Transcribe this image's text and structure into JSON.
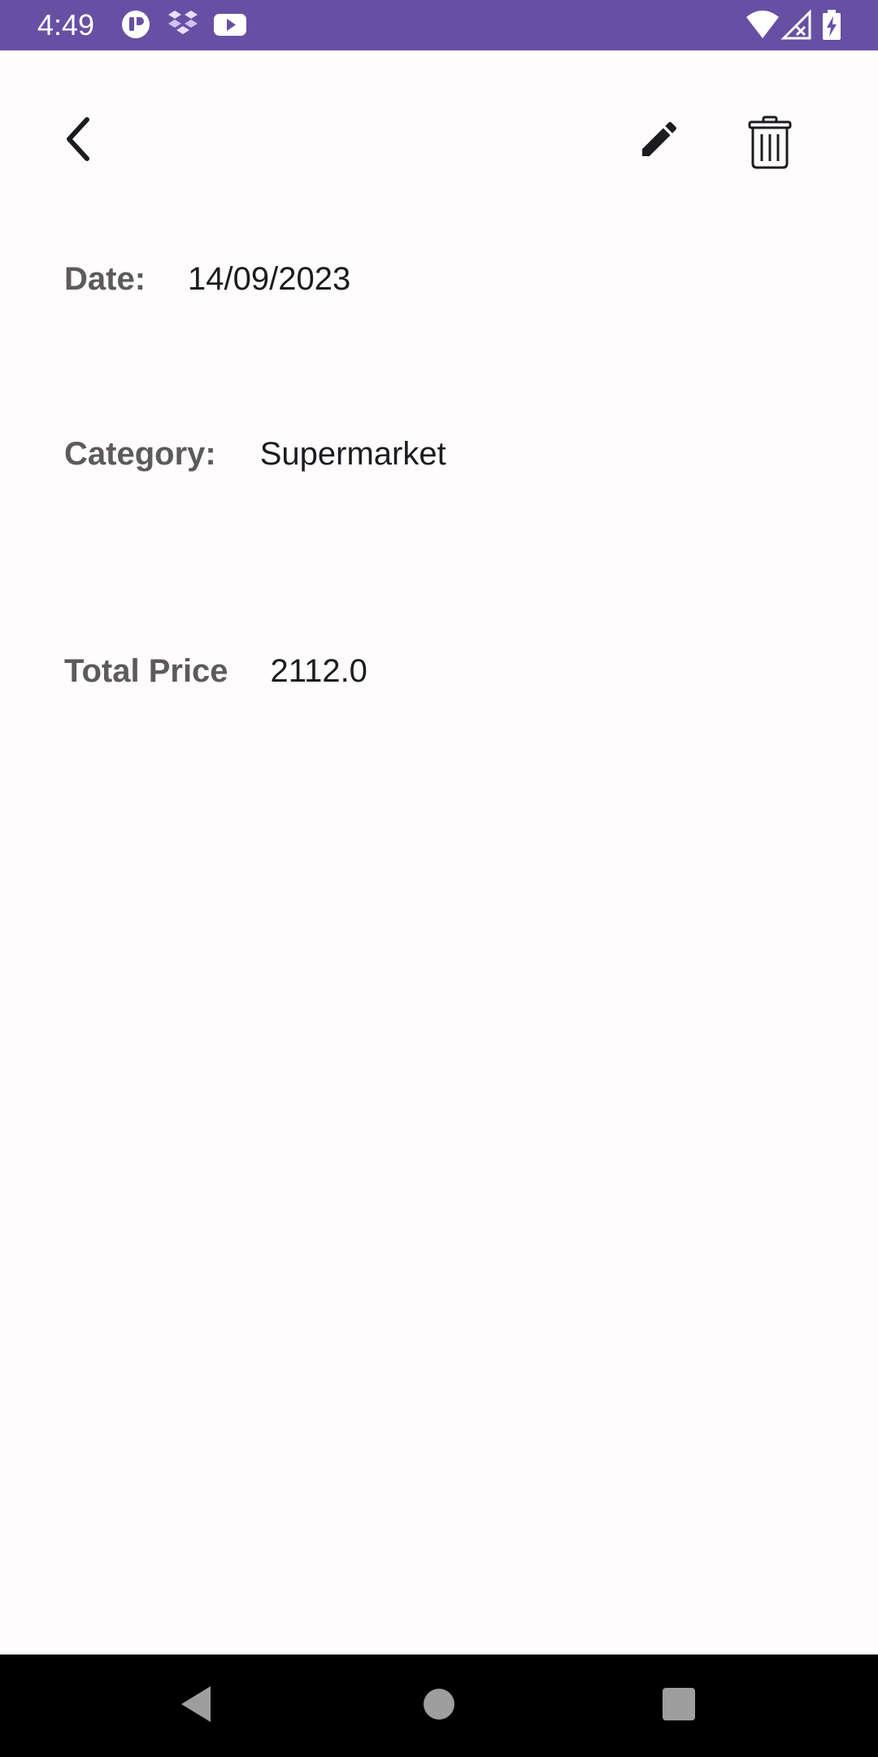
{
  "status_bar": {
    "time": "4:49",
    "background": "#6750a4",
    "left_icons": [
      "app-notification-icon",
      "dropbox-icon",
      "youtube-icon"
    ],
    "right_icons": [
      "wifi-icon",
      "cellular-signal-icon",
      "battery-charging-icon"
    ]
  },
  "app_bar": {
    "back_icon": "chevron-left-icon",
    "edit_icon": "pencil-icon",
    "delete_icon": "trash-icon"
  },
  "details": {
    "date_label": "Date:",
    "date_value": "14/09/2023",
    "category_label": "Category:",
    "category_value": "Supermarket",
    "total_label": "Total Price",
    "total_value": "2112.0"
  },
  "nav_bar": {
    "icons": [
      "back-triangle-icon",
      "home-circle-icon",
      "recents-square-icon"
    ]
  }
}
